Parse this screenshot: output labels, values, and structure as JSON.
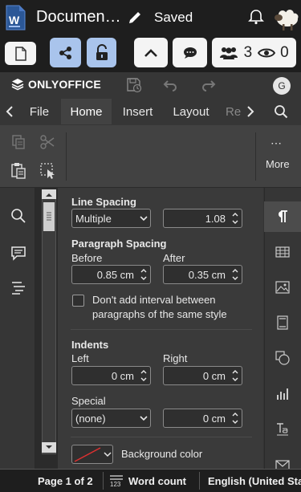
{
  "title_bar": {
    "document_title": "Documen…",
    "status": "Saved",
    "icons": [
      "word-doc-icon",
      "pencil-icon",
      "bell-icon",
      "sheep-avatar"
    ]
  },
  "collab_bar": {
    "users_count": "3",
    "viewers_count": "0",
    "icons": [
      "new-doc-icon",
      "share-icon",
      "unlock-icon",
      "chevron-up-icon",
      "chat-icon",
      "users-icon",
      "eye-icon"
    ]
  },
  "app_header": {
    "brand": "ONLYOFFICE",
    "user_initial": "G"
  },
  "tabs": [
    {
      "label": "File"
    },
    {
      "label": "Home",
      "active": true
    },
    {
      "label": "Insert"
    },
    {
      "label": "Layout"
    },
    {
      "label": "Re"
    }
  ],
  "ribbon": {
    "more_label": "More",
    "more_dots": "⋯"
  },
  "paragraph_settings": {
    "line_spacing": {
      "heading": "Line Spacing",
      "type": "Multiple",
      "value": "1.08"
    },
    "paragraph_spacing": {
      "heading": "Paragraph Spacing",
      "before_label": "Before",
      "before_value": "0.85 cm",
      "after_label": "After",
      "after_value": "0.35 cm"
    },
    "no_interval_checkbox": {
      "line1": "Don't add interval between",
      "line2": "paragraphs of the same style",
      "checked": false
    },
    "indents": {
      "heading": "Indents",
      "left_label": "Left",
      "left_value": "0 cm",
      "right_label": "Right",
      "right_value": "0 cm",
      "special_label": "Special",
      "special_type": "(none)",
      "special_value": "0 cm"
    },
    "background_color_label": "Background color"
  },
  "status_bar": {
    "page_label": "Page 1 of 2",
    "word_count_label": "Word count",
    "language_label": "English (United Sta"
  },
  "colors": {
    "accent_blue": "#a9c4ec",
    "panel_bg": "#3a3a3a",
    "title_bg": "#1e1e1e"
  }
}
